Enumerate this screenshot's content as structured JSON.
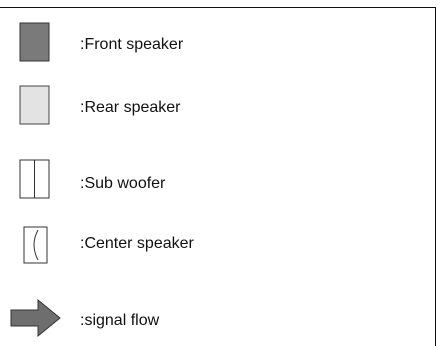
{
  "legend": {
    "items": [
      {
        "icon": "front-speaker-icon",
        "label": ":Front speaker",
        "color": "#7a7a7a"
      },
      {
        "icon": "rear-speaker-icon",
        "label": ":Rear speaker",
        "color": "#e3e3e3"
      },
      {
        "icon": "sub-woofer-icon",
        "label": ":Sub woofer",
        "color": "#ffffff"
      },
      {
        "icon": "center-speaker-icon",
        "label": ":Center speaker",
        "color": "#ffffff"
      },
      {
        "icon": "signal-flow-arrow-icon",
        "label": ":signal flow",
        "color": "#6e6e6e"
      }
    ]
  }
}
